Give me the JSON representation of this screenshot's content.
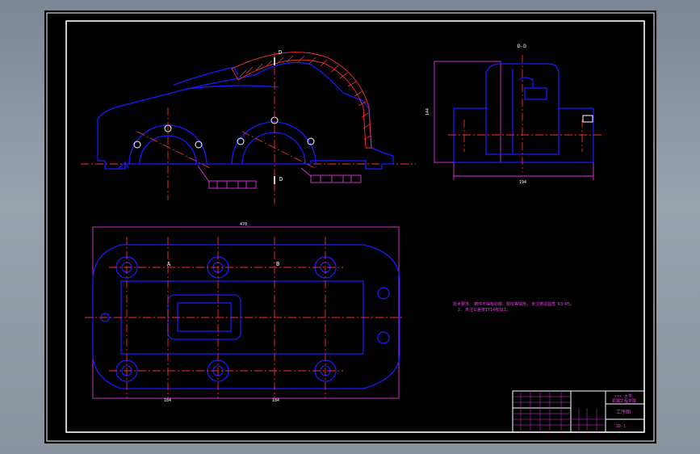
{
  "drawing": {
    "section_label_top": "D",
    "section_label_bottom": "D",
    "side_view_title": "D-D",
    "side_view_dim_height": "144",
    "side_view_dim_width": "194",
    "plan_dim_overall": "470",
    "plan_dim_left": "184",
    "plan_dim_right": "184",
    "datum_left": "A",
    "datum_right": "B"
  },
  "notes": {
    "line1": "技术要求: 铸件不得有砂眼、裂纹等缺陷, 未注铸造圆角 R3~R5。",
    "line2": "2. 未注公差按IT14级加工。"
  },
  "title_block": {
    "company_line1": "××× 大学",
    "company_line2": "机械工程学院",
    "drawing_name": "工序图",
    "drawing_code": "ZD-1"
  },
  "colors": {
    "background": "#000000",
    "outline": "#1a1aff",
    "centerline": "#ff2a2a",
    "dimension": "#e030e0",
    "border": "#ffffff"
  }
}
